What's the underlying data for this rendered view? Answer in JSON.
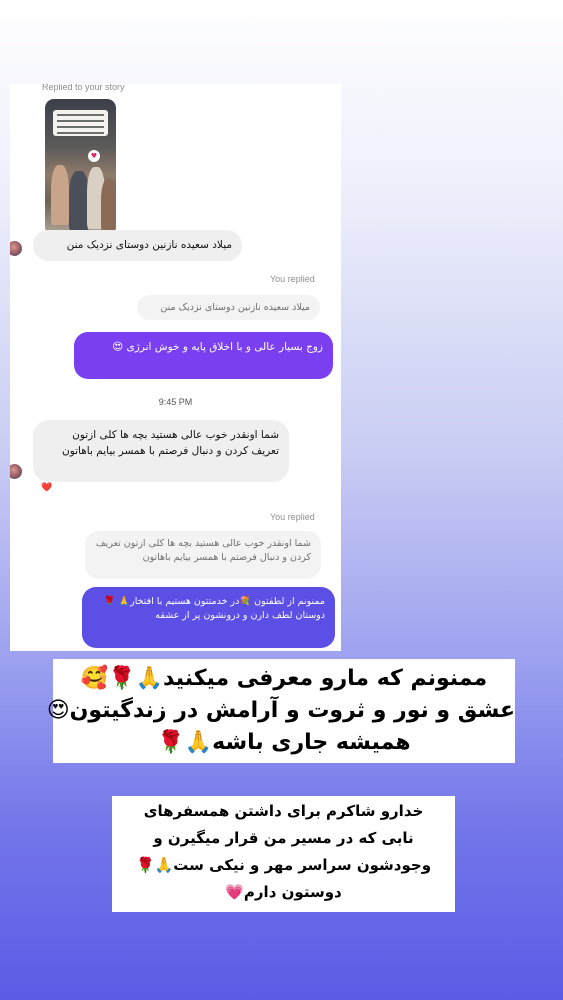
{
  "story_reply": {
    "replied_label": "Replied to your story"
  },
  "messages": {
    "incoming_1": "میلاد سعیده نازنین دوستای نزدیک منن",
    "you_replied_1": "You replied",
    "quote_1": "میلاد سعیده نازنین دوستای نزدیک منن",
    "outgoing_1": "زوج بسیار عالی   و با اخلاق    پایه    و خوش انرژی 😍",
    "time_1": "9:45 PM",
    "incoming_2": "شما اونقدر خوب عالی هستید بچه ها کلی ازتون تعریف کردن و دنبال فرصتم با همسر بیایم باهاتون",
    "incoming_2_reaction": "❤️",
    "you_replied_2": "You replied",
    "quote_2": "شما اونقدر خوب عالی هستید بچه ها کلی ازتون تعریف کردن و دنبال فرصتم با همسر بیایم باهاتون",
    "outgoing_2": "ممنونم از لطفتون 💐در خدمتتون هستیم با افتخار🙏 🌹 دوستان لطف دارن و درونشون پر از عشقه"
  },
  "caption_1": {
    "line1": "ممنونم که مارو معرفی میکنید🙏🌹🥰",
    "line2": "عشق و نور و ثروت و آرامش در زندگیتون😍",
    "line3": "همیشه جاری باشه🙏🌹"
  },
  "caption_2": {
    "line1": "خدارو شاکرم برای داشتن همسفرهای",
    "line2": "نابی که در مسیر من قرار میگیرن و",
    "line3": "وجودشون سراسر مهر و نیکی ست🙏🌹",
    "line4": "دوستون دارم💗"
  },
  "colors": {
    "outgoing_bubble": "#7a3ff0",
    "outgoing_bubble_2": "#5b4fe6",
    "incoming_bubble": "#efefef",
    "background_bottom": "#5b5be6"
  }
}
